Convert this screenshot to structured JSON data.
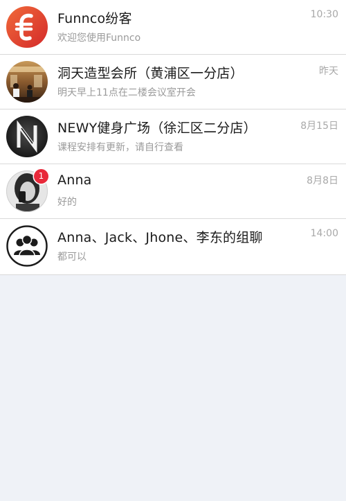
{
  "conversations": [
    {
      "title": "Funnco纷客",
      "preview": "欢迎您使用Funnco",
      "time": "10:30",
      "avatar": "funnco-logo"
    },
    {
      "title": "洞天造型会所（黄浦区一分店）",
      "preview": "明天早上11点在二楼会议室开会",
      "time": "昨天",
      "avatar": "salon-photo"
    },
    {
      "title": "NEWY健身广场（徐汇区二分店）",
      "preview": "课程安排有更新，请自行查看",
      "time": "8月15日",
      "avatar": "newy-logo"
    },
    {
      "title": "Anna",
      "preview": "好的",
      "time": "8月8日",
      "avatar": "user-photo",
      "unread": "1"
    },
    {
      "title": "Anna、Jack、Jhone、李东的组聊",
      "preview": "都可以",
      "time": "14:00",
      "avatar": "group-icon"
    }
  ],
  "colors": {
    "background": "#eff2f7",
    "list_background": "#ffffff",
    "funnco_brand": "#e2412b",
    "badge": "#e8293a",
    "title_text": "#1a1a1a",
    "muted_text": "#9a9a9a"
  }
}
